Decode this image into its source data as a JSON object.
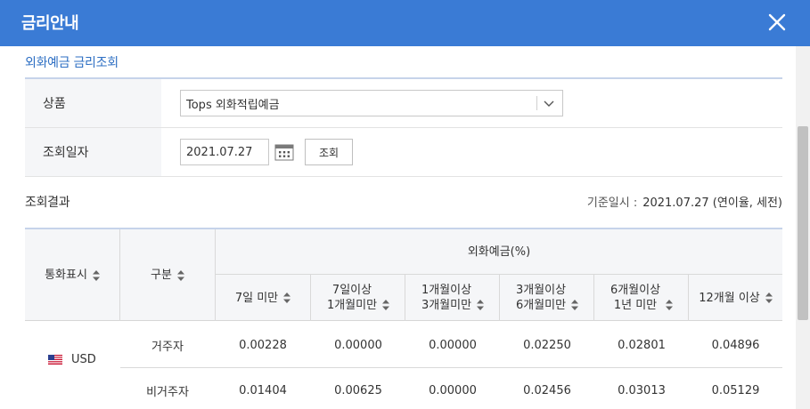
{
  "modal": {
    "title": "금리안내",
    "close_label": "close"
  },
  "section_title": "외화예금 금리조회",
  "form": {
    "product_label": "상품",
    "product_value": "Tops 외화적립예금",
    "date_label": "조회일자",
    "date_value": "2021.07.27",
    "search_button": "조회"
  },
  "results": {
    "title": "조회결과",
    "basis_label": "기준일시 :",
    "basis_value": "2021.07.27 (연이율, 세전)",
    "header": {
      "currency": "통화표시",
      "category": "구분",
      "group": "외화예금(%)",
      "periods": [
        {
          "line1": "7일 미만",
          "line2": ""
        },
        {
          "line1": "7일이상",
          "line2": "1개월미만"
        },
        {
          "line1": "1개월이상",
          "line2": "3개월미만"
        },
        {
          "line1": "3개월이상",
          "line2": "6개월미만"
        },
        {
          "line1": "6개월이상",
          "line2": "1년 미만"
        },
        {
          "line1": "12개월 이상",
          "line2": ""
        }
      ]
    },
    "currency": "USD",
    "rows": [
      {
        "category": "거주자",
        "values": [
          "0.00228",
          "0.00000",
          "0.00000",
          "0.02250",
          "0.02801",
          "0.04896"
        ]
      },
      {
        "category": "비거주자",
        "values": [
          "0.01404",
          "0.00625",
          "0.00000",
          "0.02456",
          "0.03013",
          "0.05129"
        ]
      }
    ]
  },
  "colors": {
    "header_bg": "#3a7bd5",
    "accent_text": "#2e6fc3"
  }
}
